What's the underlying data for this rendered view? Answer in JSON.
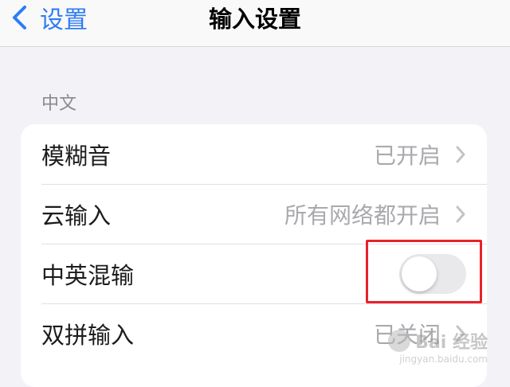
{
  "navbar": {
    "back_label": "设置",
    "title": "输入设置"
  },
  "section": {
    "header": "中文"
  },
  "rows": [
    {
      "label": "模糊音",
      "value": "已开启",
      "icon": "chevron-right-icon"
    },
    {
      "label": "云输入",
      "value": "所有网络都开启",
      "icon": "chevron-right-icon"
    },
    {
      "label": "中英混输",
      "toggle_on": false
    },
    {
      "label": "双拼输入",
      "value": "已关闭",
      "icon": "chevron-right-icon"
    }
  ],
  "watermark": {
    "name": "Bai 经验",
    "url": "jingyan.baidu.com"
  },
  "colors": {
    "accent": "#2f7cf6",
    "highlight": "#e8212b",
    "background": "#f2f2f7"
  }
}
